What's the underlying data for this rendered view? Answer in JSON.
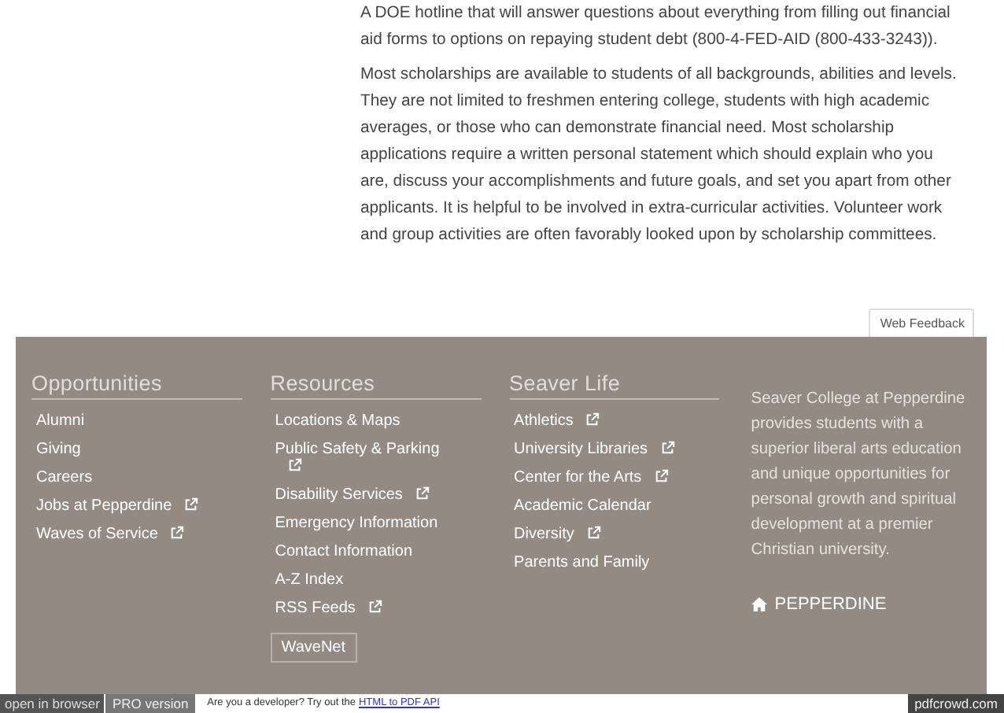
{
  "article": {
    "paragraphs": [
      "A DOE hotline that will answer questions about everything from filling out financial aid forms to options on repaying student debt (800-4-FED-AID (800-433-3243)).",
      "Most scholarships are available to students of all backgrounds, abilities and levels. They are not limited to freshmen entering college, students with high academic averages, or those who can demonstrate financial need. Most scholarship applications require a written personal statement which should explain who you are, discuss your accomplishments and future goals, and set you apart from other applicants. It is helpful to be involved in extra-curricular activities. Volunteer work and group activities are often favorably looked upon by scholarship committees."
    ]
  },
  "feedback_button": "Web Feedback",
  "footer": {
    "columns": [
      {
        "heading": "Opportunities",
        "links": [
          {
            "label": "Alumni",
            "external": false
          },
          {
            "label": "Giving",
            "external": false
          },
          {
            "label": "Careers",
            "external": false
          },
          {
            "label": "Jobs at Pepperdine",
            "external": true
          },
          {
            "label": "Waves of Service",
            "external": true
          }
        ]
      },
      {
        "heading": "Resources",
        "links": [
          {
            "label": "Locations & Maps",
            "external": false
          },
          {
            "label": "Public Safety & Parking",
            "external": true
          },
          {
            "label": "Disability Services",
            "external": true
          },
          {
            "label": "Emergency Information",
            "external": false
          },
          {
            "label": "Contact Information",
            "external": false
          },
          {
            "label": "A-Z Index",
            "external": false
          },
          {
            "label": "RSS Feeds",
            "external": true
          }
        ],
        "button": "WaveNet"
      },
      {
        "heading": "Seaver Life",
        "links": [
          {
            "label": "Athletics",
            "external": true
          },
          {
            "label": "University Libraries",
            "external": true
          },
          {
            "label": "Center for the Arts",
            "external": true
          },
          {
            "label": "Academic Calendar",
            "external": false
          },
          {
            "label": "Diversity",
            "external": true
          },
          {
            "label": "Parents and Family",
            "external": false
          }
        ]
      }
    ],
    "blurb": "Seaver College at Pepperdine provides students with a superior liberal arts education and unique opportunities for personal growth and spiritual development at a premier Christian university.",
    "logo": "PEPPERDINE"
  },
  "pdf_bar": {
    "open_button": "open in browser",
    "pro_button": "PRO version",
    "promo": "Are you a developer? Try out the",
    "promo_link": "HTML to PDF API",
    "brand": "pdfcrowd.com"
  }
}
